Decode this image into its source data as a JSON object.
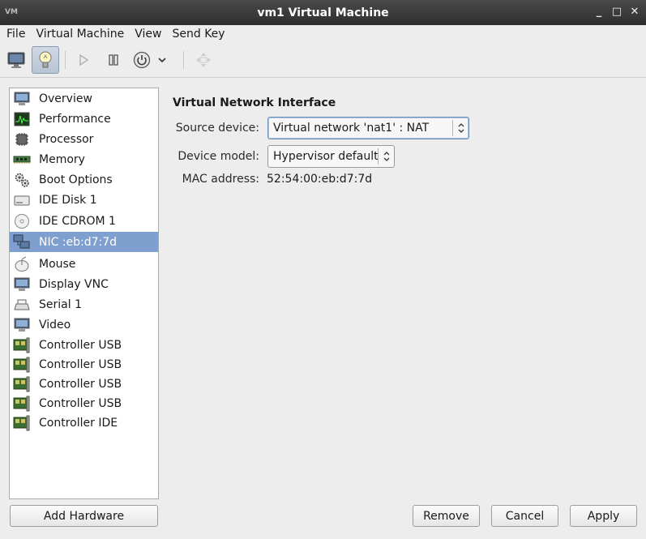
{
  "window": {
    "title": "vm1 Virtual Machine",
    "icon_text": "VM",
    "minimize": "_",
    "maximize": "□",
    "close": "✕"
  },
  "menu": [
    "File",
    "Virtual Machine",
    "View",
    "Send Key"
  ],
  "sidebar": {
    "items": [
      {
        "label": "Overview",
        "icon": "monitor-icon"
      },
      {
        "label": "Performance",
        "icon": "performance-graph-icon"
      },
      {
        "label": "Processor",
        "icon": "cpu-chip-icon"
      },
      {
        "label": "Memory",
        "icon": "ram-icon"
      },
      {
        "label": "Boot Options",
        "icon": "gears-icon"
      },
      {
        "label": "IDE Disk 1",
        "icon": "hard-disk-icon"
      },
      {
        "label": "IDE CDROM 1",
        "icon": "cdrom-icon"
      },
      {
        "label": "NIC :eb:d7:7d",
        "icon": "network-icon",
        "selected": true
      },
      {
        "label": "Mouse",
        "icon": "mouse-icon"
      },
      {
        "label": "Display VNC",
        "icon": "display-icon"
      },
      {
        "label": "Serial 1",
        "icon": "serial-icon"
      },
      {
        "label": "Video",
        "icon": "video-icon"
      },
      {
        "label": "Controller USB",
        "icon": "controller-card-icon"
      },
      {
        "label": "Controller USB",
        "icon": "controller-card-icon"
      },
      {
        "label": "Controller USB",
        "icon": "controller-card-icon"
      },
      {
        "label": "Controller USB",
        "icon": "controller-card-icon"
      },
      {
        "label": "Controller IDE",
        "icon": "controller-card-icon"
      }
    ]
  },
  "details": {
    "title": "Virtual Network Interface",
    "source_label": "Source device:",
    "source_value": "Virtual network 'nat1' : NAT",
    "model_label": "Device model:",
    "model_value": "Hypervisor default",
    "mac_label": "MAC address:",
    "mac_value": "52:54:00:eb:d7:7d"
  },
  "buttons": {
    "add_hardware": "Add Hardware",
    "remove": "Remove",
    "cancel": "Cancel",
    "apply": "Apply"
  },
  "colors": {
    "selection": "#7f9fcf",
    "titlebar": "#2e2e2e"
  }
}
